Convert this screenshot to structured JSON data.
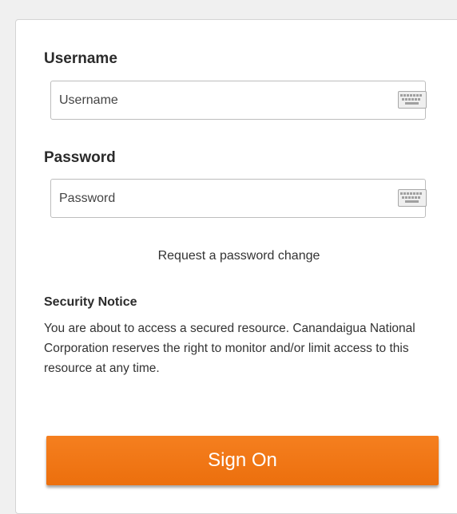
{
  "form": {
    "username_label": "Username",
    "username_placeholder": "Username",
    "password_label": "Password",
    "password_placeholder": "Password",
    "password_change_link": "Request a password change",
    "sign_on_label": "Sign On"
  },
  "security_notice": {
    "title": "Security Notice",
    "text": "You are about to access a secured resource. Canandaigua National Corporation reserves the right to monitor and/or limit access to this resource at any time."
  },
  "icons": {
    "virtual_keyboard": "keyboard-icon"
  },
  "colors": {
    "accent": "#f17616",
    "label_text": "#2b2b2b"
  }
}
